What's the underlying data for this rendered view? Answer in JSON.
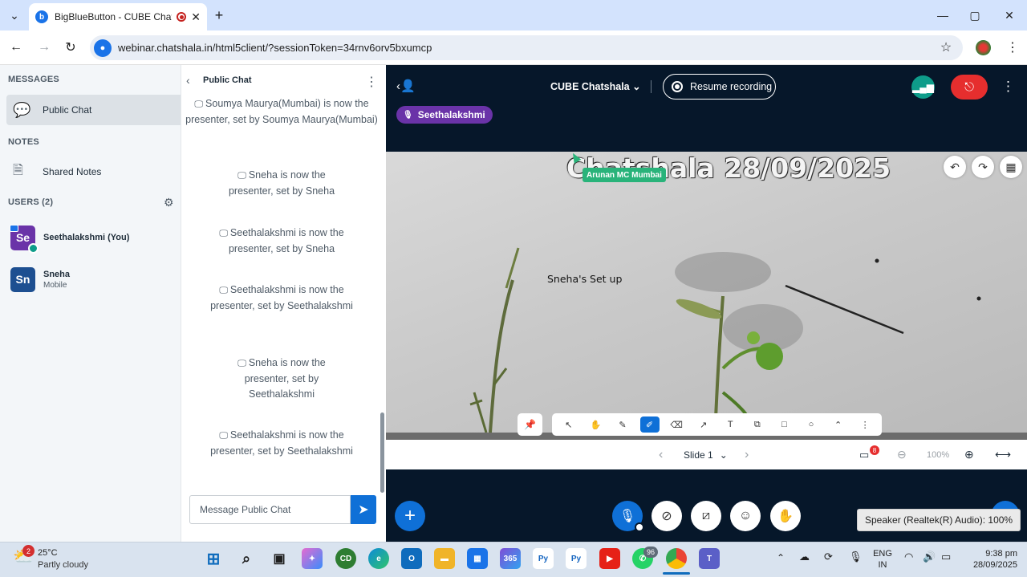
{
  "browser": {
    "tab_title": "BigBlueButton - CUBE Chatshala",
    "tab_favicon": "b",
    "new_tab": "+",
    "url": "webinar.chatshala.in/html5client/?sessionToken=34rnv6orv5bxumcp",
    "window_controls": [
      "—",
      "▢",
      "✕"
    ]
  },
  "sidebar": {
    "messages_header": "MESSAGES",
    "public_chat": "Public Chat",
    "notes_header": "NOTES",
    "shared_notes": "Shared Notes",
    "users_header": "USERS (2)",
    "users": [
      {
        "initials": "Se",
        "name": "Seethalakshmi (You)",
        "sub": "",
        "color": "#6a33a8"
      },
      {
        "initials": "Sn",
        "name": "Sneha",
        "sub": "Mobile",
        "color": "#1d4f91"
      }
    ]
  },
  "chat": {
    "title": "Public Chat",
    "messages": [
      "Soumya Maurya(Mumbai) is now the presenter, set by Soumya Maurya(Mumbai)",
      "Sneha is now the presenter, set by Sneha",
      "Seethalakshmi is now the presenter, set by Sneha",
      "Seethalakshmi is now the presenter, set by Seethalakshmi",
      "Sneha is now the presenter, set by Seethalakshmi",
      "Seethalakshmi is now the presenter, set by Seethalakshmi"
    ],
    "input_placeholder": "Message Public Chat"
  },
  "meeting": {
    "title": "CUBE Chatshala",
    "resume_recording": "Resume recording",
    "talking": "Seethalakshmi",
    "slide_title": "Chatshala 28/09/2025",
    "cursor_label": "Arunan MC Mumbai",
    "slide_note": "Sneha's Set up",
    "slide_label": "Slide 1",
    "zoom": "100%",
    "slides_badge": "8",
    "tooltip": "Speaker (Realtek(R) Audio): 100%"
  },
  "taskbar": {
    "weather_temp": "25°C",
    "weather_desc": "Partly cloudy",
    "weather_badge": "2",
    "whatsapp_badge": "96",
    "lang_top": "ENG",
    "lang_bottom": "IN",
    "time": "9:38 pm",
    "date": "28/09/2025"
  },
  "colors": {
    "accent": "#0f70d7",
    "meeting_bg": "#06172a",
    "leave": "#e62e2e",
    "connection": "#0e9c8a"
  }
}
